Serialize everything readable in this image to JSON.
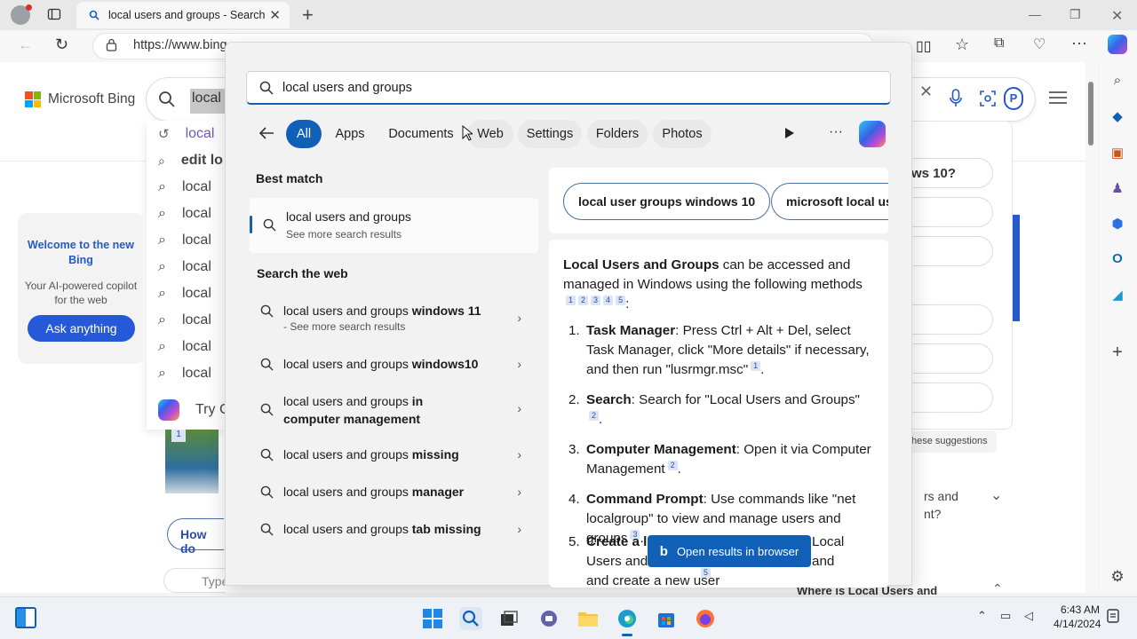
{
  "browser": {
    "tab_title": "local users and groups - Search",
    "url": "https://www.bing",
    "window_controls": [
      "minimize",
      "restore",
      "close"
    ]
  },
  "bing_page": {
    "logo_text": "Microsoft Bing",
    "query_text": "local u",
    "suggestions": [
      "local",
      "edit lo",
      "local",
      "local",
      "local",
      "local",
      "local",
      "local",
      "local",
      "local"
    ],
    "try_copilot": "Try Co",
    "welcome": {
      "title": "Welcome to the new Bing",
      "subtitle": "Your AI-powered copilot for the web",
      "button": "Ask anything"
    },
    "right_items": [
      "ws 10?",
      "hese suggestions",
      "rs and",
      "nt?",
      "Where is Local Users and"
    ],
    "how_do": "How do",
    "type_placeholder": "Type",
    "image_badge": "1"
  },
  "flyout": {
    "search_query": "local users and groups",
    "filters": [
      "All",
      "Apps",
      "Documents",
      "Web",
      "Settings",
      "Folders",
      "Photos"
    ],
    "active_filter": "All",
    "best_match_heading": "Best match",
    "best_match": {
      "title": "local users and groups",
      "subtitle": "See more search results"
    },
    "search_web_heading": "Search the web",
    "web_results": [
      {
        "base": "local users and groups ",
        "bold": "windows 11",
        "sub": "- See more search results"
      },
      {
        "base": "local users and groups ",
        "bold": "windows10",
        "sub": ""
      },
      {
        "base": "local users and groups ",
        "bold": "in computer management",
        "sub": ""
      },
      {
        "base": "local users and groups ",
        "bold": "missing",
        "sub": ""
      },
      {
        "base": "local users and groups ",
        "bold": "manager",
        "sub": ""
      },
      {
        "base": "local users and groups ",
        "bold": "tab missing",
        "sub": ""
      }
    ],
    "chips": [
      "local user groups windows 10",
      "microsoft local us"
    ],
    "answer": {
      "lead_bold": "Local Users and Groups",
      "lead_rest": " can be accessed and managed in Windows using the following methods",
      "lead_cites": [
        "1",
        "2",
        "3",
        "4",
        "5"
      ],
      "items": [
        {
          "num": "1.",
          "bold": "Task Manager",
          "text": ": Press Ctrl + Alt + Del, select Task Manager, click \"More details\" if necessary, and then run \"lusrmgr.msc\"",
          "cite": "1"
        },
        {
          "num": "2.",
          "bold": "Search",
          "text": ": Search for \"Local Users and Groups\"",
          "cite": "2"
        },
        {
          "num": "3.",
          "bold": "Computer Management",
          "text": ": Open it via Computer Management",
          "cite": "2"
        },
        {
          "num": "4.",
          "bold": "Command Prompt",
          "text": ": Use commands like \"net localgroup\" to view and manage users and groups",
          "cite": "3"
        },
        {
          "num": "5.",
          "bold": "Create a l",
          "text": "Local Users and",
          "tail": "and create a new user",
          "cite": "5"
        }
      ]
    },
    "open_in_browser": "Open results in browser"
  },
  "taskbar": {
    "time": "6:43 AM",
    "date": "4/14/2024"
  }
}
